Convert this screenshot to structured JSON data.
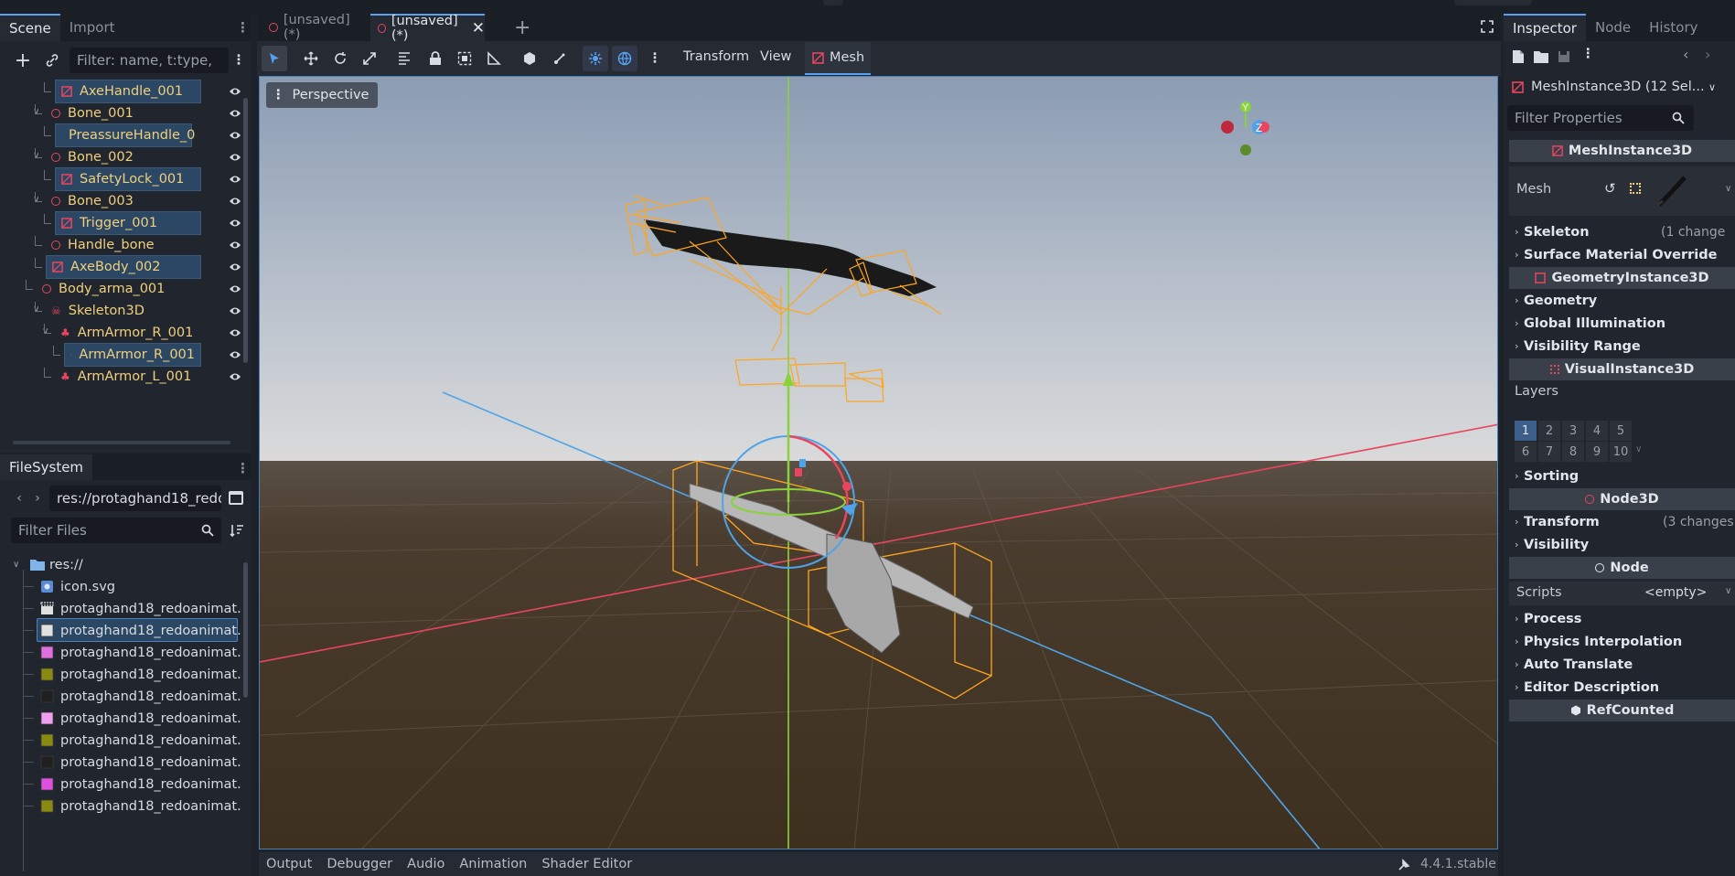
{
  "scene_panel": {
    "tabs": [
      "Scene",
      "Import"
    ],
    "filter_placeholder": "Filter: name, t:type,",
    "tree": [
      {
        "label": "AxeHandle_001",
        "kind": "mesh",
        "selected": true
      },
      {
        "label": "Bone_001",
        "kind": "bone",
        "selected": false
      },
      {
        "label": "PreassureHandle_0",
        "kind": "mesh",
        "selected": true
      },
      {
        "label": "Bone_002",
        "kind": "bone",
        "selected": false
      },
      {
        "label": "SafetyLock_001",
        "kind": "mesh",
        "selected": true
      },
      {
        "label": "Bone_003",
        "kind": "bone",
        "selected": false
      },
      {
        "label": "Trigger_001",
        "kind": "mesh",
        "selected": true
      },
      {
        "label": "Handle_bone",
        "kind": "bone",
        "selected": false
      },
      {
        "label": "AxeBody_002",
        "kind": "mesh",
        "selected": true
      },
      {
        "label": "Body_arma_001",
        "kind": "bone",
        "selected": false
      },
      {
        "label": "Skeleton3D",
        "kind": "skeleton",
        "selected": false
      },
      {
        "label": "ArmArmor_R_001",
        "kind": "bone-attach",
        "selected": false
      },
      {
        "label": "ArmArmor_R_001",
        "kind": "mesh",
        "selected": true
      },
      {
        "label": "ArmArmor_L_001",
        "kind": "bone-attach",
        "selected": false
      }
    ]
  },
  "filesystem": {
    "tab": "FileSystem",
    "path": "res://protaghand18_redoa",
    "filter_placeholder": "Filter Files",
    "root": "res://",
    "files": [
      {
        "name": "icon.svg",
        "icon": "svg-icon",
        "color": "#5b8ad6"
      },
      {
        "name": "protaghand18_redoanimat...",
        "icon": "scene-icon",
        "color": "#e0e0e0"
      },
      {
        "name": "protaghand18_redoanimat...",
        "icon": "texture-icon",
        "color": "#e0e0e0",
        "selected": true
      },
      {
        "name": "protaghand18_redoanimat...",
        "icon": "texture-icon",
        "color": "#e070e0"
      },
      {
        "name": "protaghand18_redoanimat...",
        "icon": "texture-icon",
        "color": "#8a8a10"
      },
      {
        "name": "protaghand18_redoanimat...",
        "icon": "texture-icon",
        "color": "#202020"
      },
      {
        "name": "protaghand18_redoanimat...",
        "icon": "texture-icon",
        "color": "#f0a0f0"
      },
      {
        "name": "protaghand18_redoanimat...",
        "icon": "texture-icon",
        "color": "#8a8a10"
      },
      {
        "name": "protaghand18_redoanimat...",
        "icon": "texture-icon",
        "color": "#202020"
      },
      {
        "name": "protaghand18_redoanimat...",
        "icon": "texture-icon",
        "color": "#e050e0"
      },
      {
        "name": "protaghand18_redoanimat...",
        "icon": "texture-icon",
        "color": "#8a8a10"
      }
    ]
  },
  "editor_tabs": [
    {
      "label": "[unsaved](*)",
      "active": false
    },
    {
      "label": "[unsaved](*)",
      "active": true
    }
  ],
  "viewport_toolbar": {
    "menus": [
      "Transform",
      "View"
    ],
    "mesh_menu": "Mesh",
    "perspective": "Perspective"
  },
  "bottom_tabs": [
    "Output",
    "Debugger",
    "Audio",
    "Animation",
    "Shader Editor"
  ],
  "version": "4.4.1.stable",
  "inspector": {
    "tabs": [
      "Inspector",
      "Node",
      "History"
    ],
    "object": "MeshInstance3D (12 Sel...",
    "filter_placeholder": "Filter Properties",
    "class_header": "MeshInstance3D",
    "mesh_label": "Mesh",
    "sections_a": [
      {
        "label": "Skeleton",
        "changes": "(1 change"
      },
      {
        "label": "Surface Material Override",
        "changes": ""
      }
    ],
    "geometry_header": "GeometryInstance3D",
    "sections_b": [
      {
        "label": "Geometry"
      },
      {
        "label": "Global Illumination"
      },
      {
        "label": "Visibility Range"
      }
    ],
    "visual_header": "VisualInstance3D",
    "layers_label": "Layers",
    "layers_row1": [
      "1",
      "2",
      "3",
      "4",
      "5"
    ],
    "layers_row2": [
      "6",
      "7",
      "8",
      "9",
      "10"
    ],
    "sorting": "Sorting",
    "node3d_header": "Node3D",
    "transform": "Transform",
    "transform_changes": "(3 changes",
    "visibility": "Visibility",
    "node_header": "Node",
    "scripts_label": "Scripts",
    "scripts_value": "<empty>",
    "sections_c": [
      "Process",
      "Physics Interpolation",
      "Auto Translate",
      "Editor Description"
    ],
    "refcounted_header": "RefCounted"
  },
  "colors": {
    "selection_blue": "#2b4763",
    "node_yellow": "#f0cf7e",
    "accent": "#5aa0f0",
    "x_axis": "#e8455e",
    "y_axis": "#8ad23a",
    "z_axis": "#4fa3e8",
    "gizmo_orange": "#ffa51f"
  }
}
